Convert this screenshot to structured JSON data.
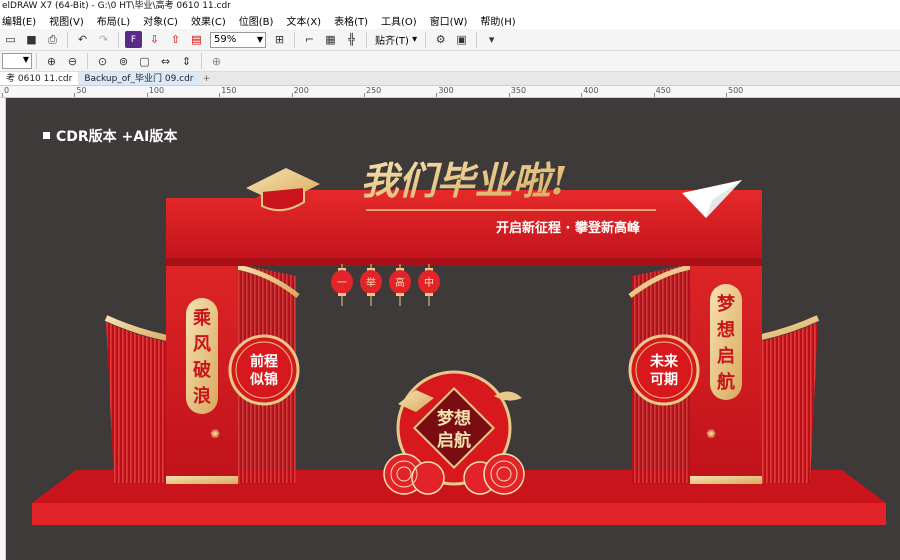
{
  "window": {
    "title": "elDRAW X7 (64-Bit) - G:\\0 HT\\毕业\\高考 0610 11.cdr"
  },
  "menu": [
    "编辑(E)",
    "视图(V)",
    "布局(L)",
    "对象(C)",
    "效果(C)",
    "位图(B)",
    "文本(X)",
    "表格(T)",
    "工具(O)",
    "窗口(W)",
    "帮助(H)"
  ],
  "toolbar": {
    "zoom_value": "59%",
    "snap_label": "贴齐(T)",
    "icons": [
      "new-icon",
      "save-icon",
      "print-icon",
      "undo-icon",
      "redo-icon",
      "import-icon",
      "export-icon",
      "zoom-icon",
      "fullscreen-icon",
      "rulers-icon",
      "grid-icon",
      "guides-icon",
      "options-icon",
      "launch-icon"
    ]
  },
  "tabs": [
    {
      "label": "考 0610 11.cdr",
      "active": true
    },
    {
      "label": "Backup_of_毕业门 09.cdr",
      "active": false
    }
  ],
  "ruler": {
    "labels": [
      "0",
      "50",
      "100",
      "150",
      "200",
      "250",
      "300",
      "350",
      "400",
      "450",
      "500"
    ]
  },
  "canvas": {
    "caption": "CDR版本 +AI版本",
    "artwork": {
      "headline": "我们毕业啦!",
      "subline": "开启新征程 · 攀登新高峰",
      "lanterns": [
        "一",
        "举",
        "高",
        "中"
      ],
      "left_pillar_chars": [
        "乘",
        "风",
        "破",
        "浪"
      ],
      "right_pillar_chars": [
        "梦",
        "想",
        "启",
        "航"
      ],
      "left_medallion": [
        "前程",
        "似锦"
      ],
      "right_medallion": [
        "未来",
        "可期"
      ],
      "center_emblem": [
        "梦想",
        "启航"
      ],
      "colors": {
        "red": "#d7191e",
        "dark_red": "#9e0f14",
        "gold": "#e9c98a",
        "canvas": "#3e3a39"
      }
    }
  }
}
